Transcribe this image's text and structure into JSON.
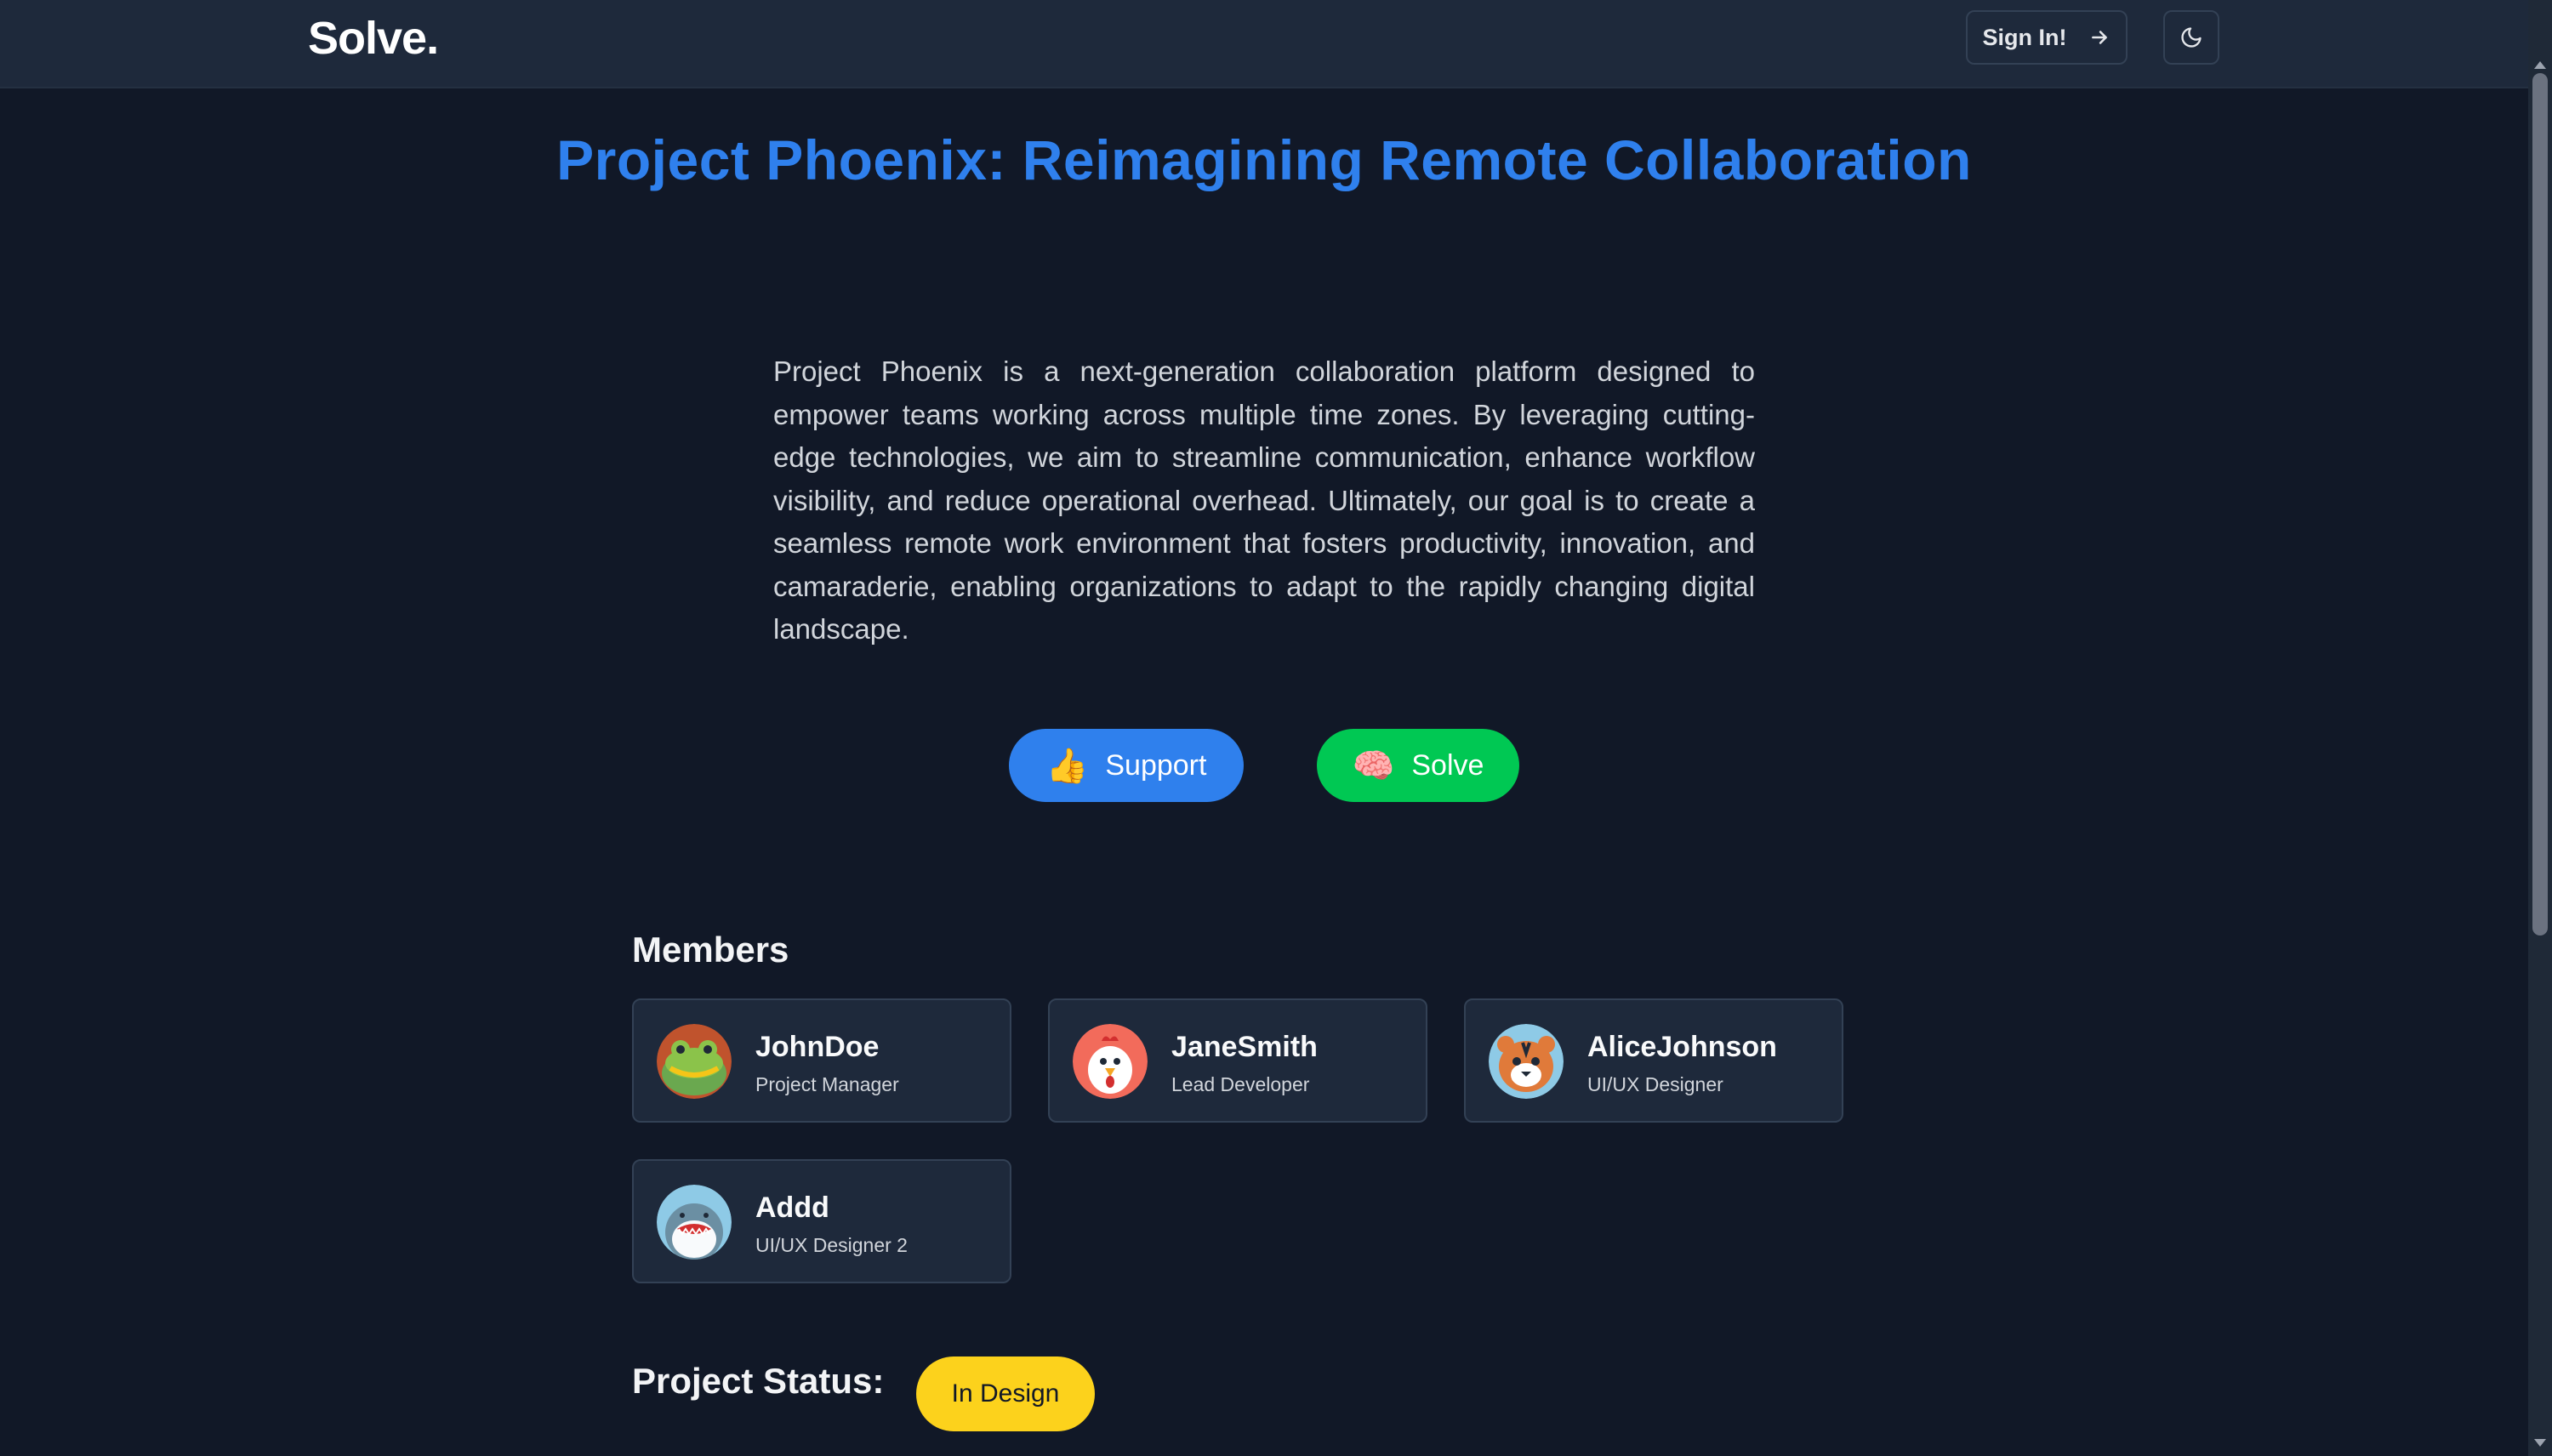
{
  "header": {
    "logo": "Solve.",
    "signin_label": "Sign In!"
  },
  "project": {
    "title": "Project Phoenix: Reimagining Remote Collaboration",
    "description": "Project Phoenix is a next-generation collaboration platform designed to empower teams working across multiple time zones. By leveraging cutting-edge technologies, we aim to streamline communication, enhance workflow visibility, and reduce operational overhead. Ultimately, our goal is to create a seamless remote work environment that fosters productivity, innovation, and camaraderie, enabling organizations to adapt to the rapidly changing digital landscape."
  },
  "actions": {
    "support_label": "Support",
    "support_emoji": "👍",
    "solve_label": "Solve",
    "solve_emoji": "🧠"
  },
  "members": {
    "heading": "Members",
    "items": [
      {
        "name": "JohnDoe",
        "role": "Project Manager",
        "avatar": "frog-avatar"
      },
      {
        "name": "JaneSmith",
        "role": "Lead Developer",
        "avatar": "chicken-avatar"
      },
      {
        "name": "AliceJohnson",
        "role": "UI/UX Designer",
        "avatar": "tiger-avatar"
      },
      {
        "name": "Addd",
        "role": "UI/UX Designer 2",
        "avatar": "shark-avatar"
      }
    ]
  },
  "status": {
    "heading": "Project Status:",
    "value": "In Design",
    "color": "#fcd21c"
  },
  "colors": {
    "background": "#111827",
    "navbar": "#1e293b",
    "accent_blue": "#2f80ed",
    "accent_green": "#00c853"
  },
  "icons": {
    "signin": "arrow-right-icon",
    "theme": "moon-icon"
  }
}
